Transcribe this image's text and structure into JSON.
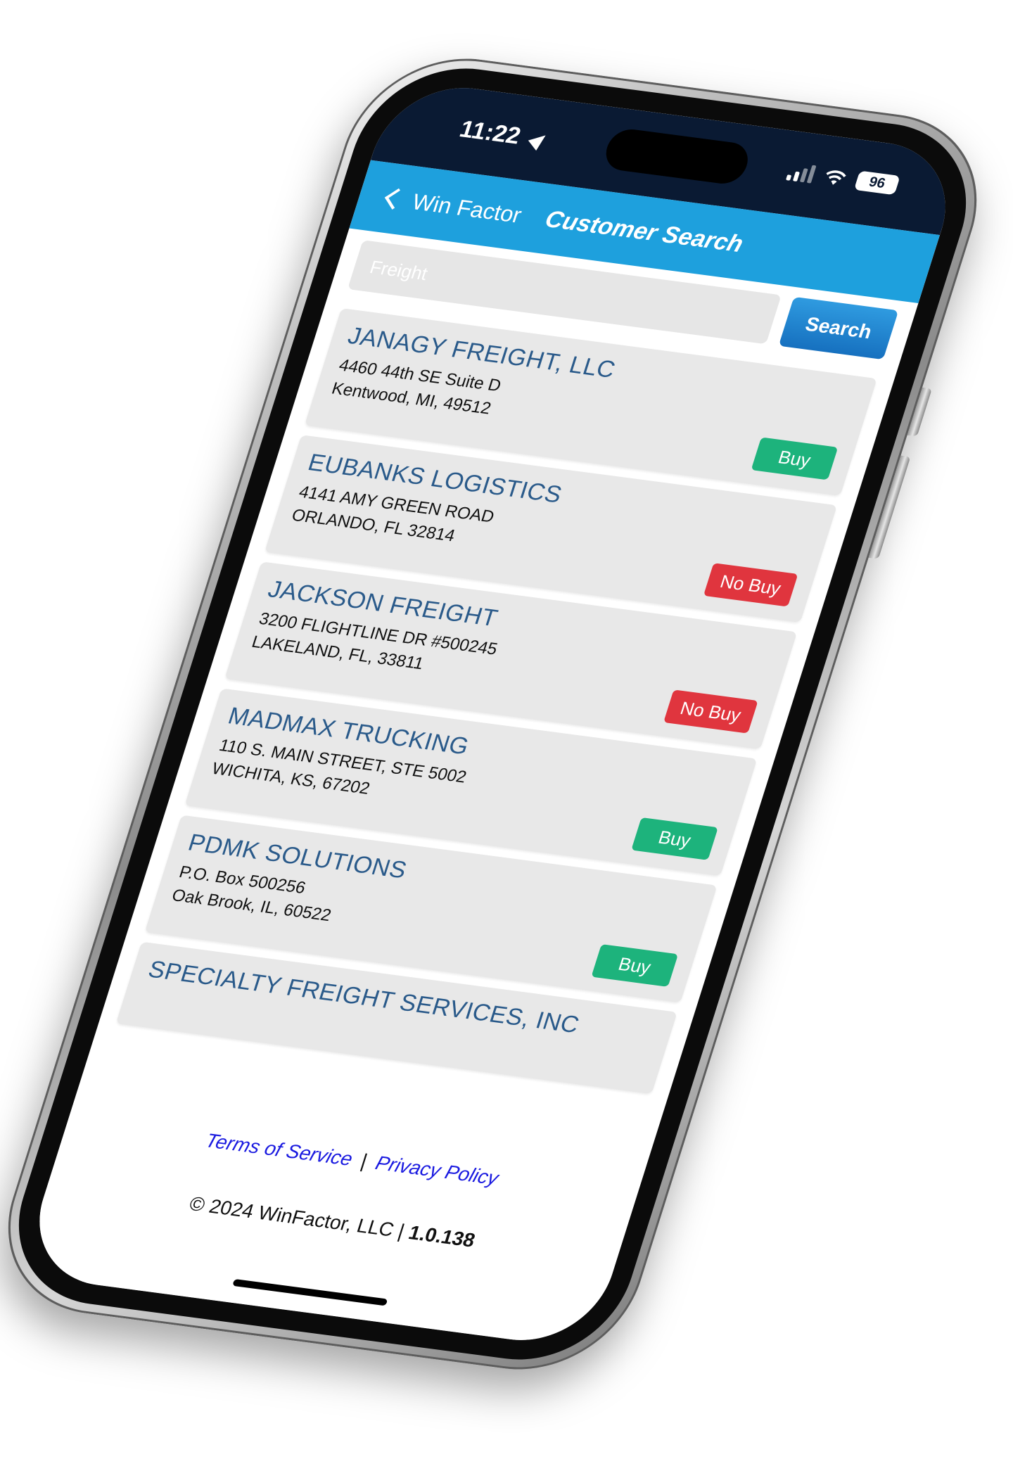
{
  "status_bar": {
    "time": "11:22",
    "battery": "96"
  },
  "nav": {
    "back_label": "Win Factor",
    "title": "Customer Search"
  },
  "search": {
    "placeholder": "Freight",
    "button_label": "Search"
  },
  "results": [
    {
      "name": "JANAGY FREIGHT, LLC",
      "address1": "4460 44th SE Suite D",
      "address2": "Kentwood, MI, 49512",
      "status": "Buy"
    },
    {
      "name": "EUBANKS LOGISTICS",
      "address1": "4141 AMY GREEN ROAD",
      "address2": "ORLANDO, FL 32814",
      "status": "No Buy"
    },
    {
      "name": "JACKSON FREIGHT",
      "address1": "3200 FLIGHTLINE DR #500245",
      "address2": "LAKELAND, FL, 33811",
      "status": "No Buy"
    },
    {
      "name": "MADMAX TRUCKING",
      "address1": "110 S. MAIN STREET, STE 5002",
      "address2": "WICHITA, KS, 67202",
      "status": "Buy"
    },
    {
      "name": "PDMK SOLUTIONS",
      "address1": "P.O. Box 500256",
      "address2": "Oak Brook, IL, 60522",
      "status": "Buy"
    },
    {
      "name": "SPECIALTY FREIGHT SERVICES, INC"
    }
  ],
  "footer": {
    "terms_label": "Terms of Service",
    "separator": "|",
    "privacy_label": "Privacy Policy",
    "copyright": "© 2024 WinFactor, LLC |",
    "version": "1.0.138"
  },
  "colors": {
    "header": "#1ea0dd",
    "status_bar": "#0a1a33",
    "buy": "#1db37c",
    "no_buy": "#e0353e",
    "company_name": "#2a5a8a",
    "link": "#1a1ae0"
  }
}
